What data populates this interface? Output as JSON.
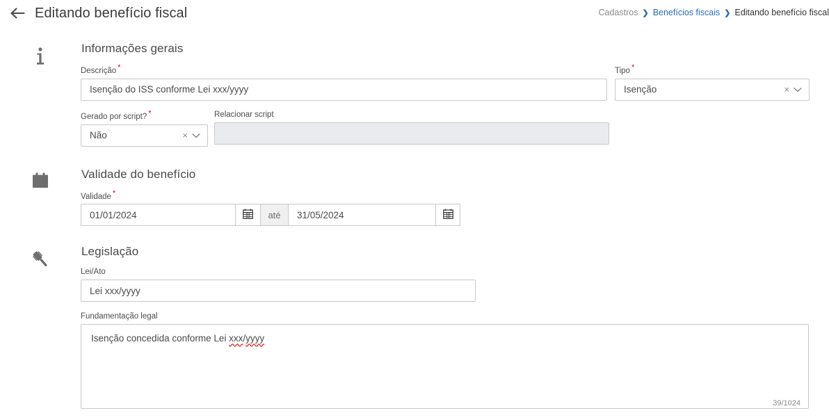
{
  "header": {
    "back_icon": "arrow-left-icon",
    "title": "Editando benefício fiscal",
    "breadcrumb": {
      "root": "Cadastros",
      "parent": "Benefícios fiscais",
      "current": "Editando benefício fiscal",
      "separator": "❯"
    }
  },
  "sections": {
    "general": {
      "icon": "info-icon",
      "title": "Informações gerais",
      "descricao": {
        "label": "Descrição",
        "required_mark": "*",
        "value": "Isenção do ISS conforme Lei xxx/yyyy",
        "placeholder": ""
      },
      "tipo": {
        "label": "Tipo",
        "required_mark": "*",
        "value": "Isenção",
        "clear_icon": "×",
        "caret_icon": "chevron-down-icon"
      },
      "gerado_por_script": {
        "label": "Gerado por script?",
        "required_mark": "*",
        "value": "Não",
        "clear_icon": "×",
        "caret_icon": "chevron-down-icon"
      },
      "relacionar_script": {
        "label": "Relacionar script",
        "value": "",
        "placeholder": "",
        "disabled": true
      }
    },
    "validade": {
      "icon": "calendar-icon",
      "title": "Validade do benefício",
      "field": {
        "label": "Validade",
        "required_mark": "*",
        "start_value": "01/01/2024",
        "separator_label": "até",
        "end_value": "31/05/2024",
        "start_picker_icon": "calendar-icon",
        "end_picker_icon": "calendar-icon"
      }
    },
    "legislacao": {
      "icon": "gavel-icon",
      "title": "Legislação",
      "lei_ato": {
        "label": "Lei/Ato",
        "value": "Lei xxx/yyyy",
        "placeholder": ""
      },
      "fundamentacao": {
        "label": "Fundamentação legal",
        "value_plain": "Isenção concedida conforme Lei ",
        "value_misspelled_1": "xxx",
        "value_slash": "/",
        "value_misspelled_2": "yyyy",
        "counter": "39/1024"
      }
    }
  },
  "colors": {
    "link": "#2b6cb8",
    "required": "#d0021b",
    "border": "#c8c8c8",
    "disabled_bg": "#e9ebee",
    "spellcheck": "#e03131",
    "icon_grey": "#6e6e6e",
    "text": "#4a4a4a"
  }
}
